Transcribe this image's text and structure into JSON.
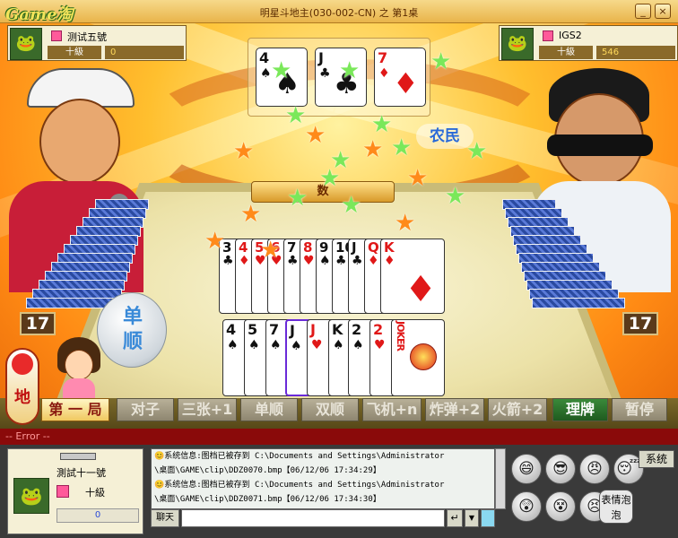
{
  "window": {
    "logo": "Game淘",
    "title": "明星斗地主(030-002-CN) 之 第1桌",
    "min_label": "_",
    "close_label": "×"
  },
  "players": {
    "left": {
      "name": "测试五號",
      "rank": "十級",
      "score": "0",
      "cards_left": "17"
    },
    "right": {
      "name": "IGS2",
      "rank": "十級",
      "score": "546",
      "cards_left": "17",
      "role": "农民"
    },
    "self": {
      "name": "測試十一號",
      "rank": "十級",
      "score": "0",
      "role": "地主"
    }
  },
  "landlord_cards": [
    {
      "rank": "4",
      "suit": "♠",
      "color": "blk"
    },
    {
      "rank": "J",
      "suit": "♣",
      "color": "blk"
    },
    {
      "rank": "7",
      "suit": "♦",
      "color": "red"
    }
  ],
  "played_cards": [
    {
      "rank": "3",
      "suit": "♣",
      "color": "blk"
    },
    {
      "rank": "4",
      "suit": "♦",
      "color": "red"
    },
    {
      "rank": "5",
      "suit": "♥",
      "color": "red"
    },
    {
      "rank": "6",
      "suit": "♥",
      "color": "red"
    },
    {
      "rank": "7",
      "suit": "♣",
      "color": "blk"
    },
    {
      "rank": "8",
      "suit": "♥",
      "color": "red"
    },
    {
      "rank": "9",
      "suit": "♠",
      "color": "blk"
    },
    {
      "rank": "10",
      "suit": "♣",
      "color": "blk"
    },
    {
      "rank": "J",
      "suit": "♣",
      "color": "blk"
    },
    {
      "rank": "Q",
      "suit": "♦",
      "color": "red"
    },
    {
      "rank": "K",
      "suit": "♦",
      "color": "red"
    }
  ],
  "hand_cards": [
    {
      "rank": "4",
      "suit": "♠",
      "color": "blk"
    },
    {
      "rank": "5",
      "suit": "♠",
      "color": "blk"
    },
    {
      "rank": "7",
      "suit": "♠",
      "color": "blk"
    },
    {
      "rank": "J",
      "suit": "♠",
      "color": "blk"
    },
    {
      "rank": "J",
      "suit": "♥",
      "color": "red"
    },
    {
      "rank": "K",
      "suit": "♠",
      "color": "blk"
    },
    {
      "rank": "2",
      "suit": "♠",
      "color": "blk"
    },
    {
      "rank": "2",
      "suit": "♥",
      "color": "red"
    },
    {
      "rank": "JOKER",
      "suit": "",
      "color": "red"
    }
  ],
  "banner": {
    "partial": "数"
  },
  "bubble": {
    "line1": "单",
    "line2": "顺"
  },
  "round_label": "第 一 局",
  "actions": [
    "对子",
    "三张+1",
    "单顺",
    "双顺",
    "飞机+n",
    "炸弹+2",
    "火箭+2"
  ],
  "sort_button": "理牌",
  "pause_button": "暂停",
  "error_text": "-- Error --",
  "chat": {
    "messages": [
      "😊系统信息:图档已被存到 C:\\Documents and Settings\\Administrator",
      "\\桌面\\GAME\\clip\\DDZ0070.bmp【06/12/06 17:34:29】",
      "😊系统信息:图档已被存到 C:\\Documents and Settings\\Administrator",
      "\\桌面\\GAME\\clip\\DDZ0071.bmp【06/12/06 17:34:30】"
    ],
    "send_label": "聊天",
    "input_value": ""
  },
  "emotes": [
    "😄",
    "😎",
    "😠",
    "😴",
    "😲",
    "😵",
    "😣"
  ],
  "emote_menu_label": "表情泡泡",
  "system_button": "系统"
}
